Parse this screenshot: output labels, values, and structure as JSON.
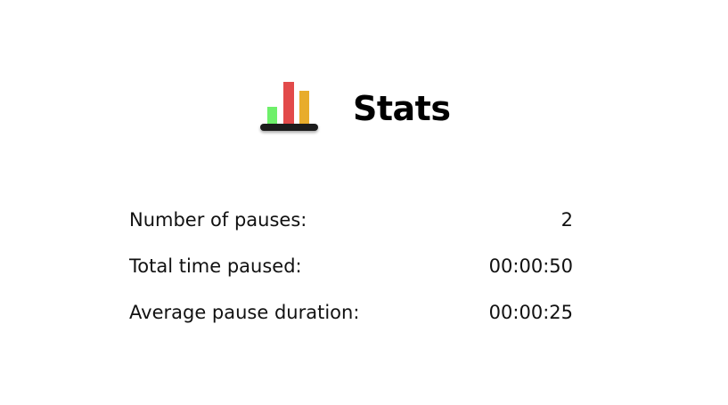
{
  "header": {
    "title": "Stats",
    "icon": "bar-chart-icon",
    "icon_colors": {
      "bar_green": "#6EF06A",
      "bar_red": "#E24A4A",
      "bar_yellow": "#E8AC2C",
      "base": "#1E1E1E"
    }
  },
  "stats": [
    {
      "label": "Number of pauses:",
      "value": "2"
    },
    {
      "label": "Total time paused:",
      "value": "00:00:50"
    },
    {
      "label": "Average pause duration:",
      "value": "00:00:25"
    }
  ]
}
